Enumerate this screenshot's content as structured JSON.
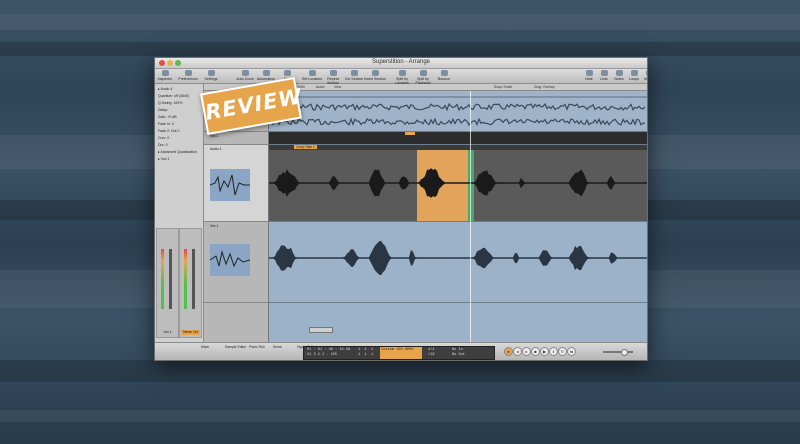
{
  "window": {
    "title": "Superstition - Arrange"
  },
  "toolbar": {
    "buttons": [
      {
        "label": "Inspector",
        "icon": "info-icon"
      },
      {
        "label": "Preferences",
        "icon": "preferences-icon"
      },
      {
        "label": "Settings",
        "icon": "settings-icon"
      },
      {
        "label": "Auto Zoom",
        "icon": "zoom-icon"
      },
      {
        "label": "Automation",
        "icon": "automation-icon"
      },
      {
        "label": "Flex",
        "icon": "flex-icon"
      },
      {
        "label": "Set Locators",
        "icon": "locators-icon"
      },
      {
        "label": "Repeat Section",
        "icon": "repeat-icon"
      },
      {
        "label": "Cut Section",
        "icon": "cut-icon"
      },
      {
        "label": "Insert Section",
        "icon": "insert-icon"
      },
      {
        "label": "Split by Locators",
        "icon": "split-icon"
      },
      {
        "label": "Split by Playhead",
        "icon": "split-playhead-icon"
      },
      {
        "label": "Bounce",
        "icon": "bounce-icon"
      },
      {
        "label": "Note",
        "icon": "note-icon"
      },
      {
        "label": "Lists",
        "icon": "lists-icon"
      },
      {
        "label": "Notes",
        "icon": "notes-icon"
      },
      {
        "label": "Loops",
        "icon": "loops-icon"
      },
      {
        "label": "Media",
        "icon": "media-icon"
      }
    ]
  },
  "inspector": {
    "lines": [
      "▸ Audio 4",
      "Quantize: off (3840)",
      "Q-Swing: 100%",
      "Delay:",
      "Gain: +0 dB",
      "Fade In: 0",
      "Fade 2: Out  0",
      "Curv: 0",
      "Dur: 0",
      "▸ Advanced Quantization",
      "▸ Vox 1"
    ],
    "strips": [
      {
        "name": "Vox 1"
      },
      {
        "name": "Stereo Out"
      }
    ]
  },
  "arrange": {
    "menu": [
      "Edit",
      "Track",
      "Region",
      "MIDI",
      "Audio",
      "View"
    ],
    "snap_label": "Snap: Smart",
    "drag_label": "Drag: Overlap",
    "tracks": [
      {
        "name": "Vox Stereo"
      },
      {
        "name": "Vox 1"
      },
      {
        "name": "Audio 4"
      },
      {
        "name": "Vox 1"
      }
    ],
    "region_name": "Audio 4",
    "comp_label": "Comp Take 1"
  },
  "bottom_tabs": [
    "Mixer",
    "Sample Editor",
    "Piano Roll",
    "Score",
    "Hyper Editor"
  ],
  "lcd": {
    "smpte": "01 : 01 : 46 : 15.58",
    "bars": "31  3  2  1 . 155",
    "division": "1  1  1\n1  1  1",
    "tempo": "Custom  120.0000",
    "sig": "4/4\n/16",
    "sync": "No In\nNo Out"
  },
  "review_badge": "REVIEW",
  "colors": {
    "accent": "#e7a54b",
    "region_selected": "#e2a45a",
    "green_marker": "#4aa86a",
    "arrange_bg": "#8da3b8",
    "dark_region": "#525252"
  }
}
